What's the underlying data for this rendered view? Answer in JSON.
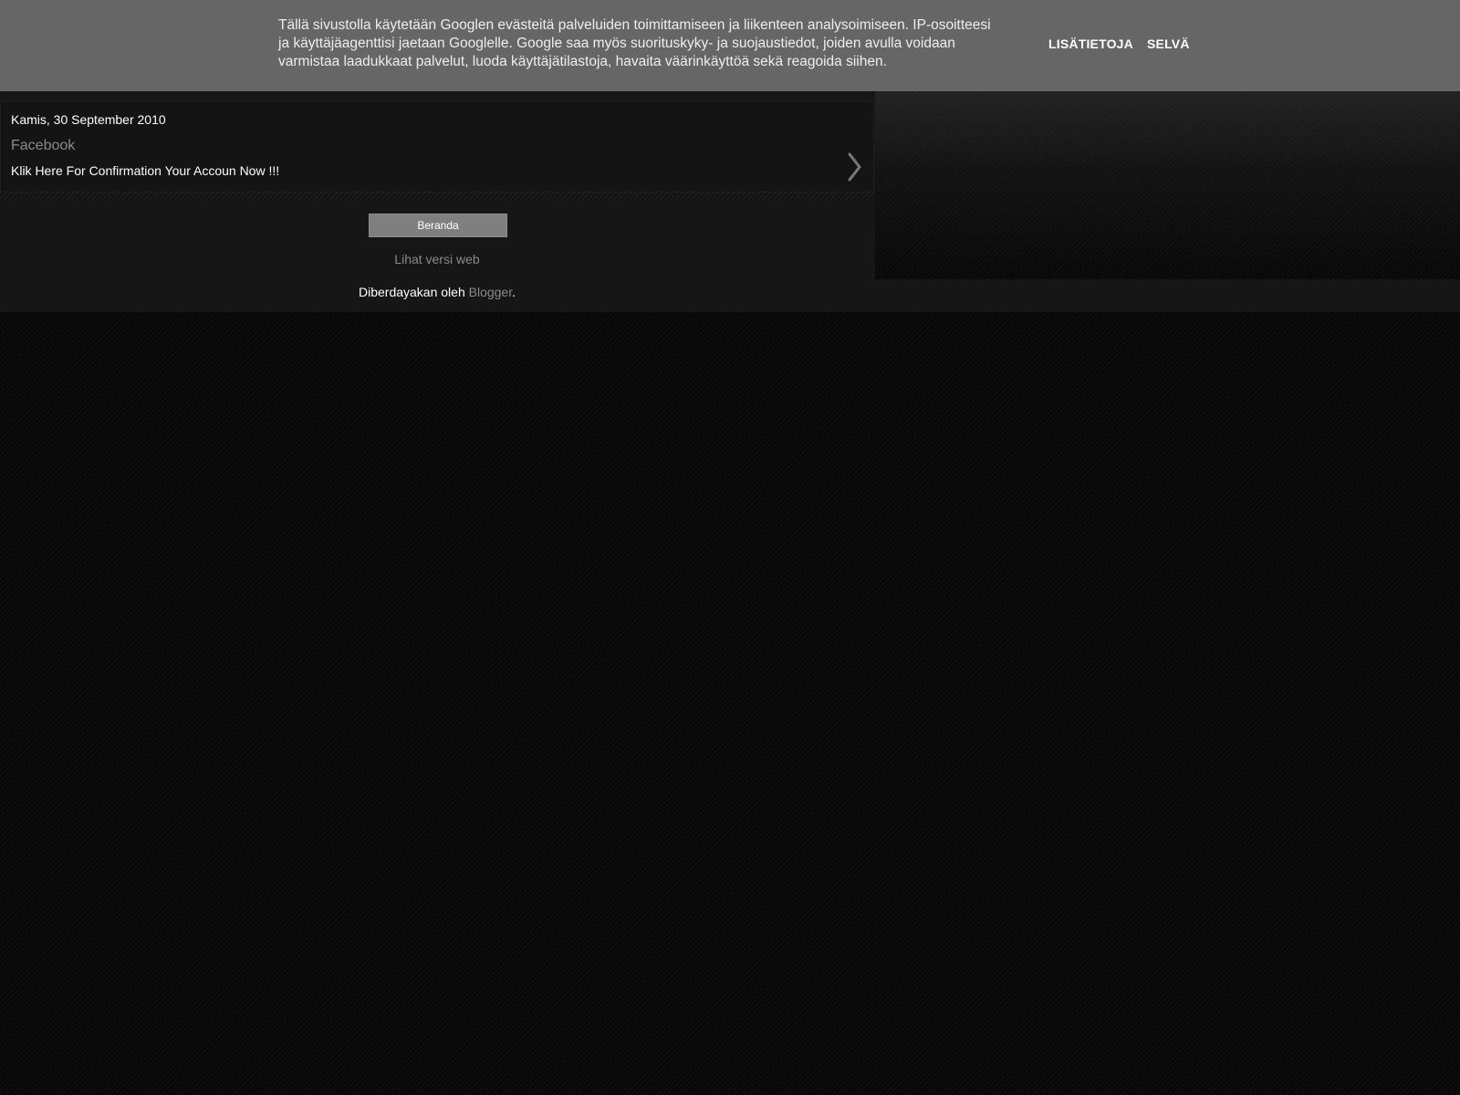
{
  "cookie_banner": {
    "text": "Tällä sivustolla käytetään Googlen evästeitä palveluiden toimittamiseen ja liikenteen analysoimiseen. IP-osoitteesi ja käyttäjäagenttisi jaetaan Googlelle. Google saa myös suorituskyky- ja suojaustiedot, joiden avulla voidaan varmistaa laadukkaat palvelut, luoda käyttäjätilastoja, havaita väärinkäyttöä sekä reagoida siihen.",
    "learn_more_label": "LISÄTIETOJA",
    "ok_label": "SELVÄ"
  },
  "post": {
    "date": "Kamis, 30 September 2010",
    "title": "Facebook",
    "snippet": "Klik Here For Confirmation Your Accoun Now !!!",
    "next_icon": "chevron-right-icon"
  },
  "footer": {
    "home_label": "Beranda",
    "web_version_label": "Lihat versi web",
    "powered_prefix": "Diberdayakan oleh",
    "powered_link": "Blogger",
    "powered_suffix": "."
  },
  "colors": {
    "banner_bg": "#666666",
    "content_bg": "#161616",
    "link_gray": "#8a8a8a",
    "button_bg": "#7f7f7f",
    "page_bg": "#0b0b0b"
  }
}
